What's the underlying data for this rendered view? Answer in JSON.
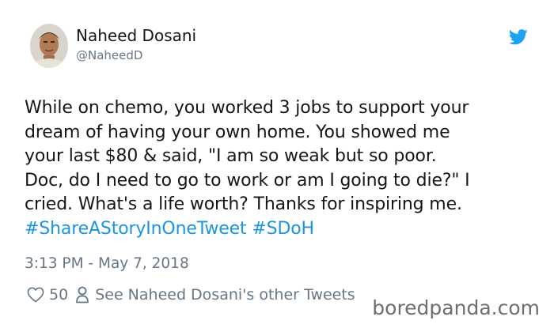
{
  "author": {
    "name": "Naheed Dosani",
    "handle": "@NaheedD"
  },
  "tweet": {
    "lines": [
      "While on chemo, you worked 3 jobs to support your",
      "dream of having your own home. You showed me",
      "your last $80 & said, \"I am so weak but so poor.",
      "Doc, do I need to go to work or am I going to die?\" I",
      "cried. What's a life worth? Thanks for inspiring me."
    ],
    "hashtags": [
      "#ShareAStoryInOneTweet",
      "#SDoH"
    ],
    "timestamp": "3:13 PM - May 7, 2018"
  },
  "actions": {
    "like_count": "50",
    "other_tweets_label": "See Naheed Dosani's other Tweets"
  },
  "icons": {
    "brand": "twitter-bird-icon",
    "like": "heart-icon",
    "profile": "person-icon"
  },
  "colors": {
    "twitter_blue": "#1da1f2",
    "hashtag": "#1b95e0",
    "muted": "#657786",
    "text": "#14171a"
  },
  "watermark": "boredpanda.com"
}
